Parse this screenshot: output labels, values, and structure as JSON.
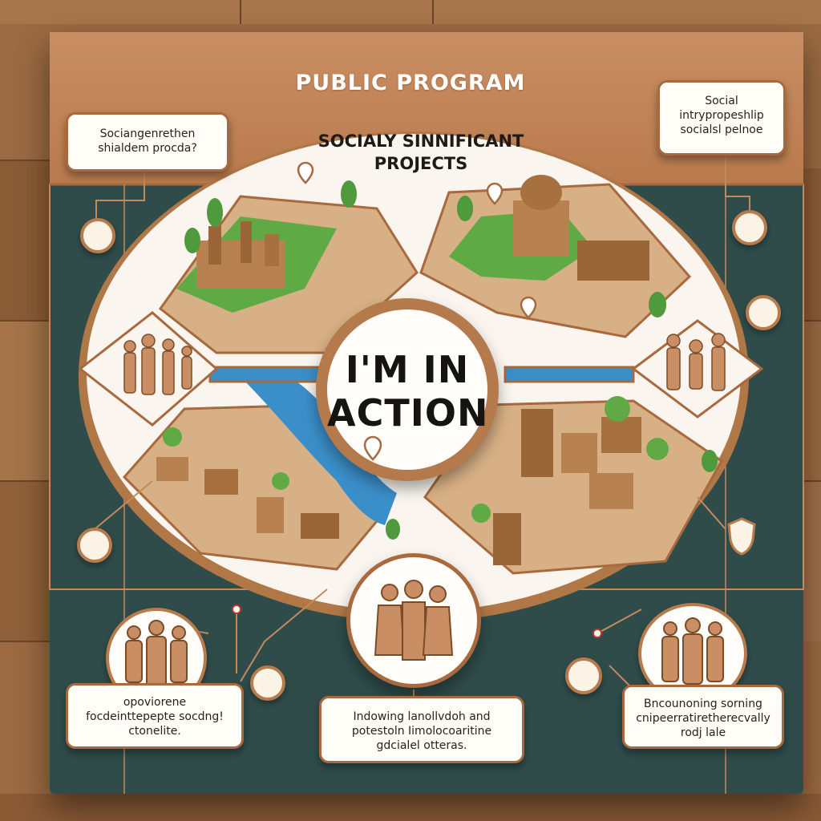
{
  "header": {
    "title": "PUBLIC PROGRAM"
  },
  "subtitle": {
    "line1": "SOCIALY SINNIFICANT",
    "line2": "PROJECTS"
  },
  "center": {
    "line1": "I'M IN",
    "line2": "ACTION"
  },
  "cards": {
    "top_left": [
      "Sociangenrethen",
      "shialdem procda?"
    ],
    "top_right": [
      "Social",
      "intrypropeshlip",
      "socialsl pelnoe"
    ],
    "bottom_left": [
      "opoviorene",
      "focdeinttepepte socdng!",
      "ctonelite."
    ],
    "bottom_center": [
      "Indowing lanollvdoh and",
      "potestoln Iimolocoaritine",
      "gdcialel otteras."
    ],
    "bottom_right": [
      "Bncounoning sorning",
      "cnipeerratiretherecvally",
      "rodj lale"
    ]
  },
  "colors": {
    "board": "#2f4c4b",
    "header": "#c98e63",
    "accent": "#a8693e",
    "card": "#fffdf7",
    "green": "#4f9a3c",
    "water": "#3b8fc9"
  },
  "icons": [
    "person-group-icon",
    "location-pin-icon",
    "heart-icon",
    "shield-icon",
    "tree-icon",
    "house-icon"
  ]
}
